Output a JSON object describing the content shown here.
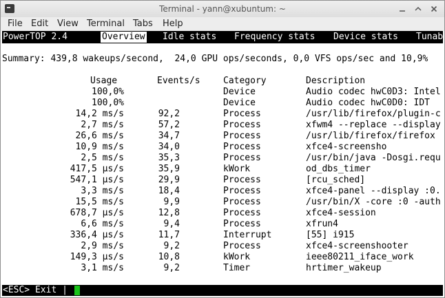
{
  "window": {
    "title": "Terminal - yann@xubuntum: ~"
  },
  "menu": [
    "File",
    "Edit",
    "View",
    "Terminal",
    "Tabs",
    "Help"
  ],
  "powertop": {
    "app": "PowerTOP 2.4",
    "tabs": [
      "Overview",
      "Idle stats",
      "Frequency stats",
      "Device stats",
      "Tunab"
    ],
    "active_tab": 0
  },
  "summary": "Summary: 439,8 wakeups/second,  24,0 GPU ops/seconds, 0,0 VFS ops/sec and 10,9%",
  "table": {
    "headers": {
      "usage": "Usage",
      "events": "Events/s",
      "category": "Category",
      "description": "Description"
    },
    "rows": [
      {
        "usage": "100,0%",
        "events": "",
        "category": "Device",
        "description": "Audio codec hwC0D3: Intel"
      },
      {
        "usage": "100,0%",
        "events": "",
        "category": "Device",
        "description": "Audio codec hwC0D0: IDT"
      },
      {
        "usage": "14,2 ms/s",
        "events": "92,2",
        "category": "Process",
        "description": "/usr/lib/firefox/plugin-c"
      },
      {
        "usage": "2,7 ms/s",
        "events": "57,2",
        "category": "Process",
        "description": "xfwm4 --replace --display"
      },
      {
        "usage": "26,6 ms/s",
        "events": "34,7",
        "category": "Process",
        "description": "/usr/lib/firefox/firefox"
      },
      {
        "usage": "10,9 ms/s",
        "events": "34,0",
        "category": "Process",
        "description": "xfce4-screensho"
      },
      {
        "usage": "2,5 ms/s",
        "events": "35,3",
        "category": "Process",
        "description": "/usr/bin/java -Dosgi.requ"
      },
      {
        "usage": "417,5 µs/s",
        "events": "35,9",
        "category": "kWork",
        "description": "od_dbs_timer"
      },
      {
        "usage": "547,1 µs/s",
        "events": "29,9",
        "category": "Process",
        "description": "[rcu_sched]"
      },
      {
        "usage": "3,3 ms/s",
        "events": "18,4",
        "category": "Process",
        "description": "xfce4-panel --display :0."
      },
      {
        "usage": "15,5 ms/s",
        "events": "9,9",
        "category": "Process",
        "description": "/usr/bin/X -core :0 -auth"
      },
      {
        "usage": "678,7 µs/s",
        "events": "12,8",
        "category": "Process",
        "description": "xfce4-session"
      },
      {
        "usage": "6,6 ms/s",
        "events": "9,4",
        "category": "Process",
        "description": "xfrun4"
      },
      {
        "usage": "336,4 µs/s",
        "events": "11,7",
        "category": "Interrupt",
        "description": "[55] i915"
      },
      {
        "usage": "2,9 ms/s",
        "events": "9,2",
        "category": "Process",
        "description": "xfce4-screenshooter"
      },
      {
        "usage": "149,3 µs/s",
        "events": "10,8",
        "category": "kWork",
        "description": "ieee80211_iface_work"
      },
      {
        "usage": "3,1 ms/s",
        "events": "9,2",
        "category": "Timer",
        "description": "hrtimer_wakeup"
      }
    ]
  },
  "status": {
    "text": "<ESC> Exit |"
  },
  "colors": {
    "cursor": "#19c219",
    "bar_bg": "#000000",
    "bar_fg": "#ffffff"
  }
}
